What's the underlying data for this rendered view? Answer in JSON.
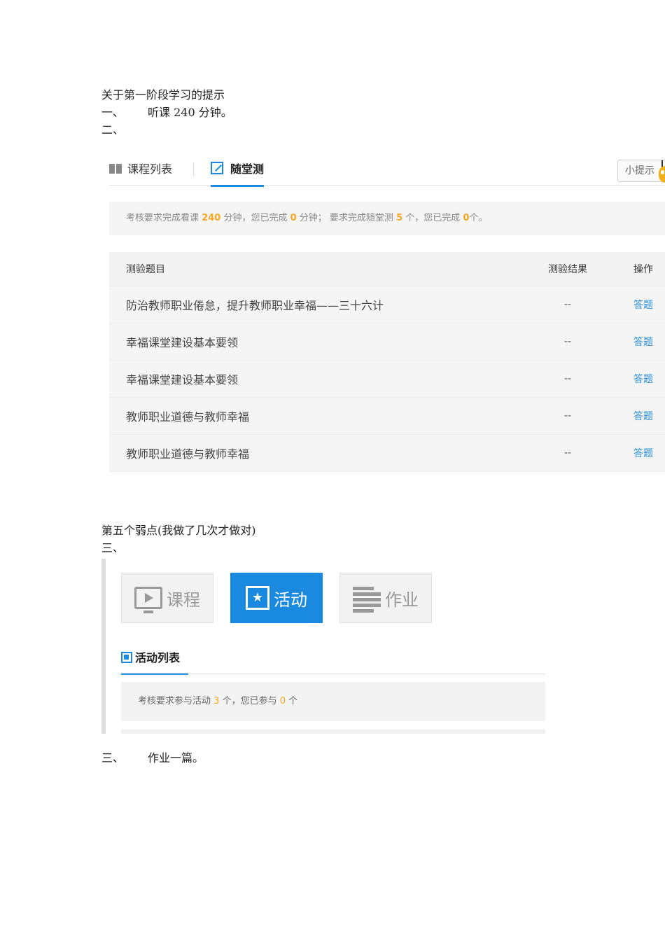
{
  "doc": {
    "title": "关于第一阶段学习的提示",
    "item1_num": "一、",
    "item1_text": "听课 240 分钟。",
    "item2_num": "二、",
    "weak_point": "第五个弱点(我做了几次才做对)",
    "item3a_num": "三、",
    "item3b_num": "三、",
    "item3b_text": "作业一篇。"
  },
  "quiz_panel": {
    "tab_courses": "课程列表",
    "tab_quiz": "随堂测",
    "tip_button": "小提示",
    "notice": {
      "p1": "考核要求完成看课",
      "watch_required": "240",
      "p2": "分钟，您已完成",
      "watch_done": "0",
      "p3": "分钟；  要求完成随堂测",
      "quiz_required": "5",
      "p4": "个，您已完成",
      "quiz_done": "0",
      "p5": "个。"
    },
    "table": {
      "headers": [
        "测验题目",
        "测验结果",
        "操作"
      ],
      "rows": [
        {
          "title": "防治教师职业倦怠，提升教师职业幸福——三十六计",
          "result": "--",
          "action": "答题"
        },
        {
          "title": "幸福课堂建设基本要领",
          "result": "--",
          "action": "答题"
        },
        {
          "title": "幸福课堂建设基本要领",
          "result": "--",
          "action": "答题"
        },
        {
          "title": "教师职业道德与教师幸福",
          "result": "--",
          "action": "答题"
        },
        {
          "title": "教师职业道德与教师幸福",
          "result": "--",
          "action": "答题"
        }
      ]
    }
  },
  "activity_panel": {
    "cards": [
      {
        "label": "课程",
        "icon": "play-monitor-icon"
      },
      {
        "label": "活动",
        "icon": "star-activity-icon"
      },
      {
        "label": "作业",
        "icon": "document-list-icon"
      }
    ],
    "sub_tab": "活动列表",
    "notice": {
      "p1": "考核要求参与活动",
      "required": "3",
      "p2": "个，您已参与",
      "done": "0",
      "p3": "个"
    }
  },
  "colors": {
    "accent": "#1a8ae0",
    "highlight": "#f5a623",
    "link": "#2a8fd8"
  }
}
